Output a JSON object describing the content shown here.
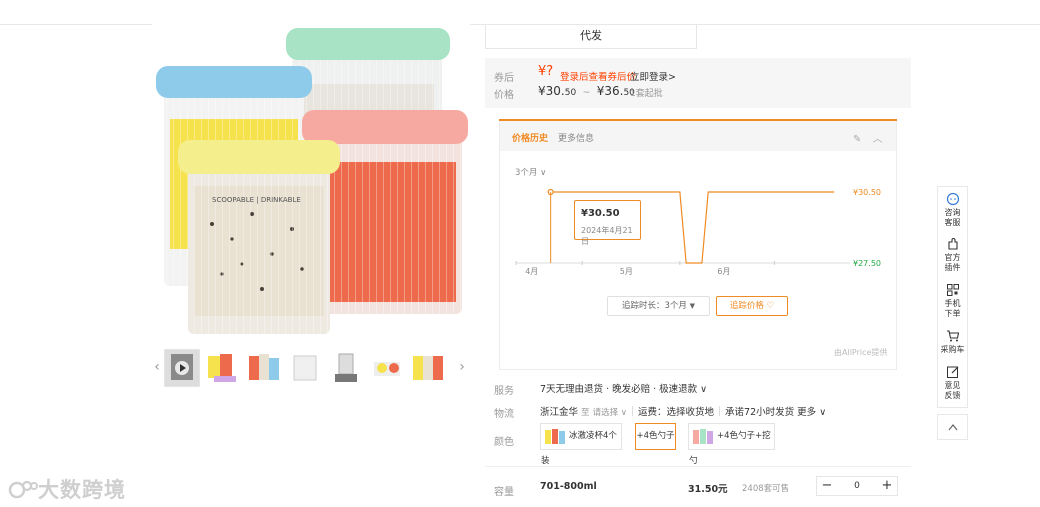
{
  "shipping_mode": "代发",
  "price_section": {
    "coupon_label": "券后",
    "coupon_symbol": "¥?",
    "coupon_link": "登录后查看券后价",
    "login_link": "立即登录>",
    "price_label": "价格",
    "price_low_prefix": "¥30.",
    "price_low_dec": "50",
    "tilde": "~",
    "price_high_prefix": "¥36.",
    "price_high_dec": "50",
    "moq": "1套起批"
  },
  "price_history": {
    "tab_active": "价格历史",
    "tab_more": "更多信息",
    "range_select": "3个月 ∨",
    "tooltip_price": "¥30.50",
    "tooltip_date": "2024年4月21日",
    "track_duration": "追踪时长：3个月",
    "track_button": "追踪价格 ♡",
    "provider": "由AllPrice提供"
  },
  "chart_data": {
    "type": "line",
    "x_ticks": [
      "4月",
      "5月",
      "6月"
    ],
    "y_ticks": [
      "¥30.50",
      "¥27.50"
    ],
    "series": [
      {
        "points": [
          {
            "x": "2024-04-21",
            "y": 30.5
          },
          {
            "x": "2024-06-01",
            "y": 30.5
          },
          {
            "x": "2024-06-03",
            "y": 27.5
          },
          {
            "x": "2024-06-08",
            "y": 27.5
          },
          {
            "x": "2024-06-10",
            "y": 30.5
          },
          {
            "x": "2024-07-20",
            "y": 30.5
          }
        ]
      }
    ],
    "highlight": {
      "x": "2024-04-21",
      "y": 30.5
    },
    "line_color": "#f08a24",
    "max_label_color": "#f08a24",
    "min_label_color": "#22aa44"
  },
  "service": {
    "label": "服务",
    "text": "7天无理由退货 · 晚发必赔 · 极速退款 ∨"
  },
  "logistics": {
    "label": "物流",
    "origin": "浙江金华",
    "to": "至",
    "select": "请选择 ∨",
    "fee": "运费：选择收货地",
    "promise": "承诺72小时发货",
    "more": "更多 ∨"
  },
  "color": {
    "label": "颜色",
    "options": [
      "冰激凌杯4个装",
      "+4色勺子",
      "+4色勺子+挖勺"
    ],
    "selected_index": 1
  },
  "capacity": {
    "label": "容量",
    "name": "701-800ml",
    "price": "31.50元",
    "stock": "2408套可售",
    "quantity": "0",
    "minus": "−",
    "plus": "+"
  },
  "toolbar": {
    "items": [
      {
        "label1": "咨询",
        "label2": "客服"
      },
      {
        "label1": "官方",
        "label2": "插件"
      },
      {
        "label1": "手机",
        "label2": "下单"
      },
      {
        "label1": "采购车",
        "label2": ""
      },
      {
        "label1": "意见",
        "label2": "反馈"
      }
    ]
  },
  "watermark": "大数跨境",
  "colors": {
    "accent": "#f08a24",
    "red": "#ff4000",
    "green": "#22aa44"
  }
}
